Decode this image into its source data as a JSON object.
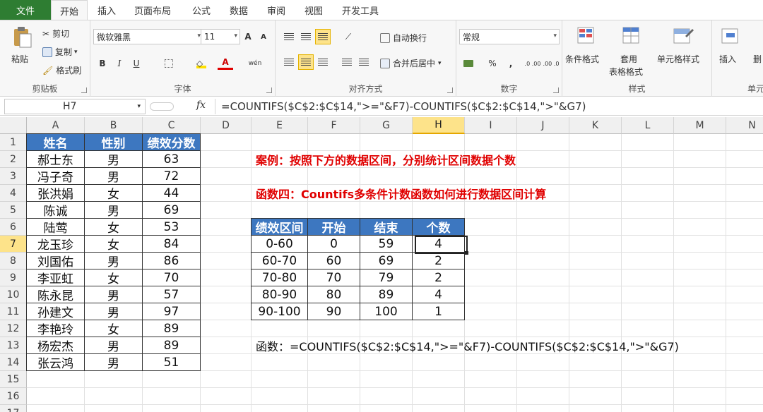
{
  "tabs": [
    "文件",
    "开始",
    "插入",
    "页面布局",
    "公式",
    "数据",
    "审阅",
    "视图",
    "开发工具"
  ],
  "clipboard": {
    "paste": "粘贴",
    "cut": "剪切",
    "copy": "复制",
    "format_painter": "格式刷",
    "label": "剪贴板"
  },
  "font": {
    "name": "微软雅黑",
    "size": "11",
    "grow": "A",
    "shrink": "A",
    "bold": "B",
    "italic": "I",
    "underline": "U",
    "wen": "wén",
    "label": "字体"
  },
  "alignment": {
    "wrap": "自动换行",
    "merge": "合并后居中",
    "label": "对齐方式"
  },
  "number": {
    "format": "常规",
    "percent": "%",
    "comma": ",",
    "inc": ".0 .00",
    "dec": ".00 .0",
    "label": "数字"
  },
  "styles": {
    "conditional": "条件格式",
    "table_1": "套用",
    "table_2": "表格格式",
    "cell_styles": "单元格样式",
    "label": "样式"
  },
  "cells": {
    "insert": "插入",
    "delete": "删",
    "label": "单元"
  },
  "formula_bar": {
    "name_box": "H7",
    "fx": "fx",
    "formula": "=COUNTIFS($C$2:$C$14,\">=\"&F7)-COUNTIFS($C$2:$C$14,\">\"&G7)"
  },
  "columns": [
    "A",
    "B",
    "C",
    "D",
    "E",
    "F",
    "G",
    "H",
    "I",
    "J",
    "K",
    "L",
    "M",
    "N"
  ],
  "rows": [
    "1",
    "2",
    "3",
    "4",
    "5",
    "6",
    "7",
    "8",
    "9",
    "10",
    "11",
    "12",
    "13",
    "14",
    "15",
    "16",
    "17"
  ],
  "table_left": {
    "headers": [
      "姓名",
      "性别",
      "绩效分数"
    ],
    "rows": [
      [
        "郝士东",
        "男",
        "63"
      ],
      [
        "冯子奇",
        "男",
        "72"
      ],
      [
        "张洪娟",
        "女",
        "44"
      ],
      [
        "陈诚",
        "男",
        "69"
      ],
      [
        "陆莺",
        "女",
        "53"
      ],
      [
        "龙玉珍",
        "女",
        "84"
      ],
      [
        "刘国佑",
        "男",
        "86"
      ],
      [
        "李亚虹",
        "女",
        "70"
      ],
      [
        "陈永昆",
        "男",
        "57"
      ],
      [
        "孙建文",
        "男",
        "97"
      ],
      [
        "李艳玲",
        "女",
        "89"
      ],
      [
        "杨宏杰",
        "男",
        "89"
      ],
      [
        "张云鸿",
        "男",
        "51"
      ]
    ]
  },
  "notes": {
    "case": "案例：按照下方的数据区间，分别统计区间数据个数",
    "func4": "函数四：Countifs多条件计数函数如何进行数据区间计算",
    "formula": "函数：=COUNTIFS($C$2:$C$14,\">=\"&F7)-COUNTIFS($C$2:$C$14,\">\"&G7)"
  },
  "table_right": {
    "headers": [
      "绩效区间",
      "开始",
      "结束",
      "个数"
    ],
    "rows": [
      [
        "0-60",
        "0",
        "59",
        "4"
      ],
      [
        "60-70",
        "60",
        "69",
        "2"
      ],
      [
        "70-80",
        "70",
        "79",
        "2"
      ],
      [
        "80-90",
        "80",
        "89",
        "4"
      ],
      [
        "90-100",
        "90",
        "100",
        "1"
      ]
    ]
  },
  "colors": {
    "file_tab": "#2e7d32",
    "header_fill": "#3d77c0",
    "selection": "#fde38a",
    "note_red": "#e00000"
  }
}
